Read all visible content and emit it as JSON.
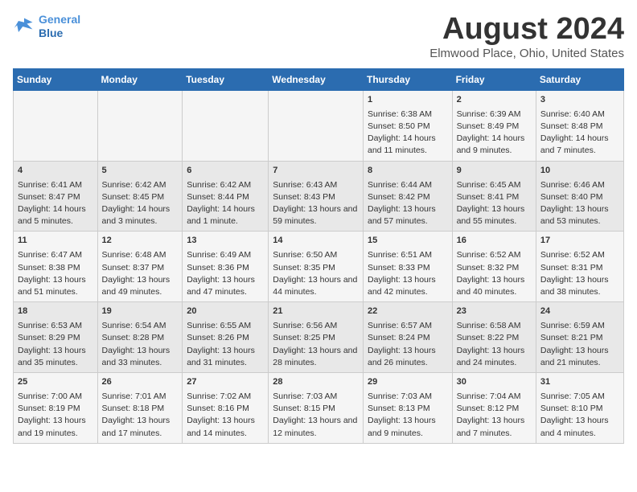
{
  "header": {
    "logo_line1": "General",
    "logo_line2": "Blue",
    "month": "August 2024",
    "location": "Elmwood Place, Ohio, United States"
  },
  "weekdays": [
    "Sunday",
    "Monday",
    "Tuesday",
    "Wednesday",
    "Thursday",
    "Friday",
    "Saturday"
  ],
  "weeks": [
    [
      {
        "day": "",
        "info": ""
      },
      {
        "day": "",
        "info": ""
      },
      {
        "day": "",
        "info": ""
      },
      {
        "day": "",
        "info": ""
      },
      {
        "day": "1",
        "info": "Sunrise: 6:38 AM\nSunset: 8:50 PM\nDaylight: 14 hours and 11 minutes."
      },
      {
        "day": "2",
        "info": "Sunrise: 6:39 AM\nSunset: 8:49 PM\nDaylight: 14 hours and 9 minutes."
      },
      {
        "day": "3",
        "info": "Sunrise: 6:40 AM\nSunset: 8:48 PM\nDaylight: 14 hours and 7 minutes."
      }
    ],
    [
      {
        "day": "4",
        "info": "Sunrise: 6:41 AM\nSunset: 8:47 PM\nDaylight: 14 hours and 5 minutes."
      },
      {
        "day": "5",
        "info": "Sunrise: 6:42 AM\nSunset: 8:45 PM\nDaylight: 14 hours and 3 minutes."
      },
      {
        "day": "6",
        "info": "Sunrise: 6:42 AM\nSunset: 8:44 PM\nDaylight: 14 hours and 1 minute."
      },
      {
        "day": "7",
        "info": "Sunrise: 6:43 AM\nSunset: 8:43 PM\nDaylight: 13 hours and 59 minutes."
      },
      {
        "day": "8",
        "info": "Sunrise: 6:44 AM\nSunset: 8:42 PM\nDaylight: 13 hours and 57 minutes."
      },
      {
        "day": "9",
        "info": "Sunrise: 6:45 AM\nSunset: 8:41 PM\nDaylight: 13 hours and 55 minutes."
      },
      {
        "day": "10",
        "info": "Sunrise: 6:46 AM\nSunset: 8:40 PM\nDaylight: 13 hours and 53 minutes."
      }
    ],
    [
      {
        "day": "11",
        "info": "Sunrise: 6:47 AM\nSunset: 8:38 PM\nDaylight: 13 hours and 51 minutes."
      },
      {
        "day": "12",
        "info": "Sunrise: 6:48 AM\nSunset: 8:37 PM\nDaylight: 13 hours and 49 minutes."
      },
      {
        "day": "13",
        "info": "Sunrise: 6:49 AM\nSunset: 8:36 PM\nDaylight: 13 hours and 47 minutes."
      },
      {
        "day": "14",
        "info": "Sunrise: 6:50 AM\nSunset: 8:35 PM\nDaylight: 13 hours and 44 minutes."
      },
      {
        "day": "15",
        "info": "Sunrise: 6:51 AM\nSunset: 8:33 PM\nDaylight: 13 hours and 42 minutes."
      },
      {
        "day": "16",
        "info": "Sunrise: 6:52 AM\nSunset: 8:32 PM\nDaylight: 13 hours and 40 minutes."
      },
      {
        "day": "17",
        "info": "Sunrise: 6:52 AM\nSunset: 8:31 PM\nDaylight: 13 hours and 38 minutes."
      }
    ],
    [
      {
        "day": "18",
        "info": "Sunrise: 6:53 AM\nSunset: 8:29 PM\nDaylight: 13 hours and 35 minutes."
      },
      {
        "day": "19",
        "info": "Sunrise: 6:54 AM\nSunset: 8:28 PM\nDaylight: 13 hours and 33 minutes."
      },
      {
        "day": "20",
        "info": "Sunrise: 6:55 AM\nSunset: 8:26 PM\nDaylight: 13 hours and 31 minutes."
      },
      {
        "day": "21",
        "info": "Sunrise: 6:56 AM\nSunset: 8:25 PM\nDaylight: 13 hours and 28 minutes."
      },
      {
        "day": "22",
        "info": "Sunrise: 6:57 AM\nSunset: 8:24 PM\nDaylight: 13 hours and 26 minutes."
      },
      {
        "day": "23",
        "info": "Sunrise: 6:58 AM\nSunset: 8:22 PM\nDaylight: 13 hours and 24 minutes."
      },
      {
        "day": "24",
        "info": "Sunrise: 6:59 AM\nSunset: 8:21 PM\nDaylight: 13 hours and 21 minutes."
      }
    ],
    [
      {
        "day": "25",
        "info": "Sunrise: 7:00 AM\nSunset: 8:19 PM\nDaylight: 13 hours and 19 minutes."
      },
      {
        "day": "26",
        "info": "Sunrise: 7:01 AM\nSunset: 8:18 PM\nDaylight: 13 hours and 17 minutes."
      },
      {
        "day": "27",
        "info": "Sunrise: 7:02 AM\nSunset: 8:16 PM\nDaylight: 13 hours and 14 minutes."
      },
      {
        "day": "28",
        "info": "Sunrise: 7:03 AM\nSunset: 8:15 PM\nDaylight: 13 hours and 12 minutes."
      },
      {
        "day": "29",
        "info": "Sunrise: 7:03 AM\nSunset: 8:13 PM\nDaylight: 13 hours and 9 minutes."
      },
      {
        "day": "30",
        "info": "Sunrise: 7:04 AM\nSunset: 8:12 PM\nDaylight: 13 hours and 7 minutes."
      },
      {
        "day": "31",
        "info": "Sunrise: 7:05 AM\nSunset: 8:10 PM\nDaylight: 13 hours and 4 minutes."
      }
    ]
  ]
}
